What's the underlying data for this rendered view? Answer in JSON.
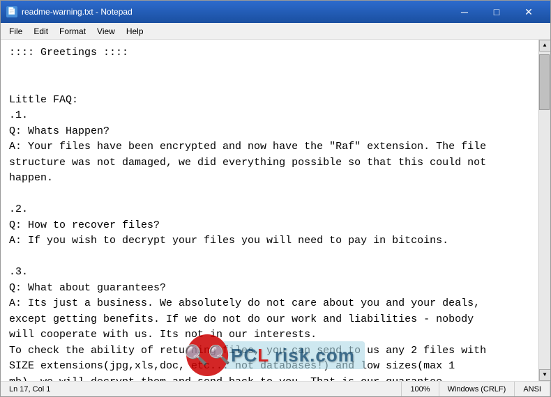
{
  "window": {
    "title": "readme-warning.txt - Notepad",
    "icon": "📄"
  },
  "titlebar": {
    "minimize_label": "─",
    "maximize_label": "□",
    "close_label": "✕"
  },
  "menubar": {
    "items": [
      {
        "label": "File"
      },
      {
        "label": "Edit"
      },
      {
        "label": "Format"
      },
      {
        "label": "View"
      },
      {
        "label": "Help"
      }
    ]
  },
  "editor": {
    "content": ":::: Greetings ::::\n\n\nLittle FAQ:\n.1.\nQ: Whats Happen?\nA: Your files have been encrypted and now have the \"Raf\" extension. The file\nstructure was not damaged, we did everything possible so that this could not\nhappen.\n\n.2.\nQ: How to recover files?\nA: If you wish to decrypt your files you will need to pay in bitcoins.\n\n.3.\nQ: What about guarantees?\nA: Its just a business. We absolutely do not care about you and your deals,\nexcept getting benefits. If we do not do our work and liabilities - nobody\nwill cooperate with us. Its not in our interests.\nTo check the ability of returning files, you can send to us any 2 files with\nSIZE extensions(jpg,xls,doc, etc... not databases!) and low sizes(max 1\nmb), we will decrypt them and send back to you. That is our guarantee."
  },
  "statusbar": {
    "position": "Ln 17, Col 1",
    "zoom": "100%",
    "line_ending": "Windows (CRLF)",
    "encoding": "ANSI"
  },
  "watermark": {
    "text": "risk.com"
  }
}
